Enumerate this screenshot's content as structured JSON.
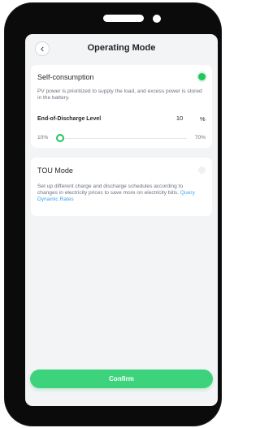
{
  "header": {
    "back_icon": "chevron-left-icon",
    "title": "Operating Mode"
  },
  "self_consumption": {
    "title": "Self-consumption",
    "selected": true,
    "description": "PV power is prioritized to supply the load, and excess power is stored in the battery.",
    "eod_label": "End-of-Discharge Level",
    "eod_value": "10",
    "eod_unit": "%",
    "slider_min": "10%",
    "slider_max": "70%",
    "slider_fraction": 0.0
  },
  "tou_mode": {
    "title": "TOU Mode",
    "selected": false,
    "description": "Set up different charge and discharge schedules according to changes in electricity prices to save more on electricity bills.",
    "link_text": "Query Dynamic Rates"
  },
  "confirm_label": "Confirm",
  "colors": {
    "accent": "#22c55e",
    "confirm_bg": "#3dd37d",
    "link": "#38a3f5"
  }
}
